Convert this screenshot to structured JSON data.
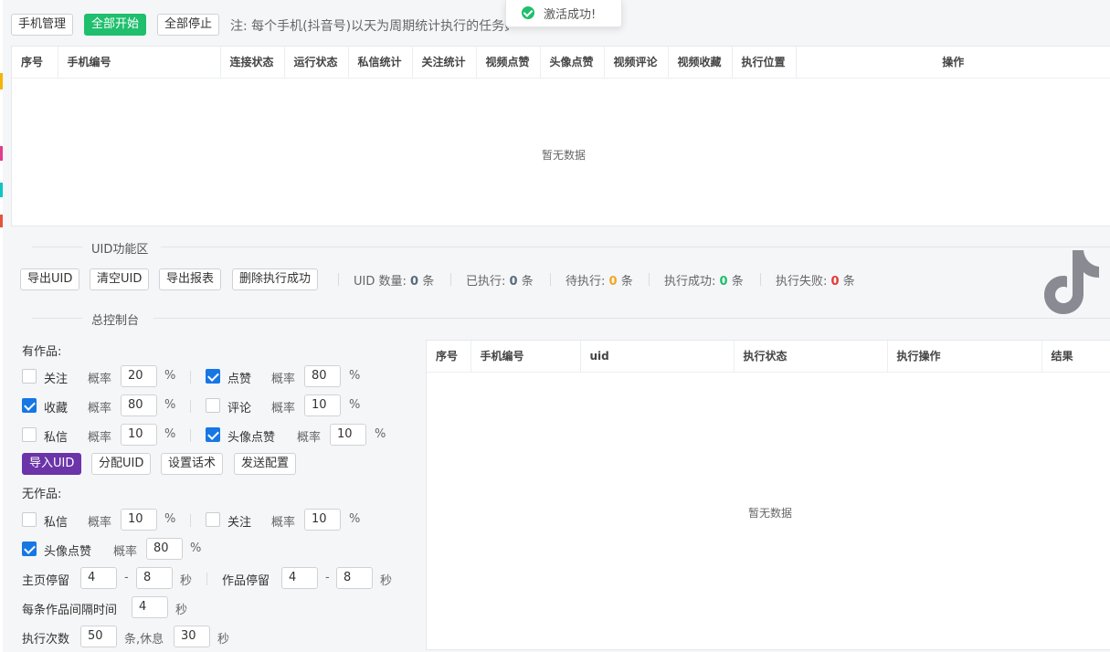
{
  "toolbar": {
    "phone_manage": "手机管理",
    "start_all": "全部开始",
    "stop_all": "全部停止",
    "note": "注: 每个手机(抖音号)以天为周期统计执行的任务数量，24点0"
  },
  "toast": {
    "message": "激活成功!"
  },
  "phone_table": {
    "columns": [
      "序号",
      "手机编号",
      "连接状态",
      "运行状态",
      "私信统计",
      "关注统计",
      "视频点赞",
      "头像点赞",
      "视频评论",
      "视频收藏",
      "执行位置",
      "操作"
    ],
    "empty_text": "暂无数据"
  },
  "uid_section": {
    "title": "UID功能区",
    "buttons": {
      "export": "导出UID",
      "clear": "清空UID",
      "export_report": "导出报表",
      "delete_success": "删除执行成功"
    },
    "stats": {
      "count_label": "UID 数量:",
      "count": "0",
      "unit": "条",
      "executed_label": "已执行:",
      "executed": "0",
      "pending_label": "待执行:",
      "pending": "0",
      "success_label": "执行成功:",
      "success": "0",
      "fail_label": "执行失败:",
      "fail": "0"
    }
  },
  "console": {
    "title": "总控制台",
    "with_works_label": "有作品:",
    "without_works_label": "无作品:",
    "prob_label": "概率",
    "percent": "%",
    "with_works": {
      "follow": {
        "label": "关注",
        "checked": false,
        "value": "20"
      },
      "like": {
        "label": "点赞",
        "checked": true,
        "value": "80"
      },
      "collect": {
        "label": "收藏",
        "checked": true,
        "value": "80"
      },
      "comment": {
        "label": "评论",
        "checked": false,
        "value": "10"
      },
      "dm": {
        "label": "私信",
        "checked": false,
        "value": "10"
      },
      "avatar_like": {
        "label": "头像点赞",
        "checked": true,
        "value": "10"
      }
    },
    "buttons": {
      "import_uid": "导入UID",
      "assign_uid": "分配UID",
      "set_script": "设置话术",
      "send_config": "发送配置"
    },
    "without_works": {
      "dm": {
        "label": "私信",
        "checked": false,
        "value": "10"
      },
      "follow": {
        "label": "关注",
        "checked": false,
        "value": "10"
      },
      "avatar_like": {
        "label": "头像点赞",
        "checked": true,
        "value": "80"
      }
    },
    "home_stay": {
      "label": "主页停留",
      "min": "4",
      "max": "8",
      "unit": "秒"
    },
    "work_stay": {
      "label": "作品停留",
      "min": "4",
      "max": "8",
      "unit": "秒"
    },
    "dash": "-",
    "interval": {
      "label": "每条作品间隔时间",
      "value": "4",
      "unit": "秒"
    },
    "exec_count": {
      "label": "执行次数",
      "value": "50",
      "unit": "条,休息",
      "rest": "30",
      "rest_unit": "秒"
    }
  },
  "uid_table": {
    "columns": [
      "序号",
      "手机编号",
      "uid",
      "执行状态",
      "执行操作",
      "结果"
    ],
    "empty_text": "暂无数据"
  },
  "colors": {
    "green": "#1fbf6d",
    "purple": "#6b34a8",
    "orange": "#f5a623",
    "red": "#e53935",
    "blue": "#1677e5"
  },
  "icons": {
    "logo": "tiktok-logo-icon",
    "toast": "check-circle-icon"
  }
}
